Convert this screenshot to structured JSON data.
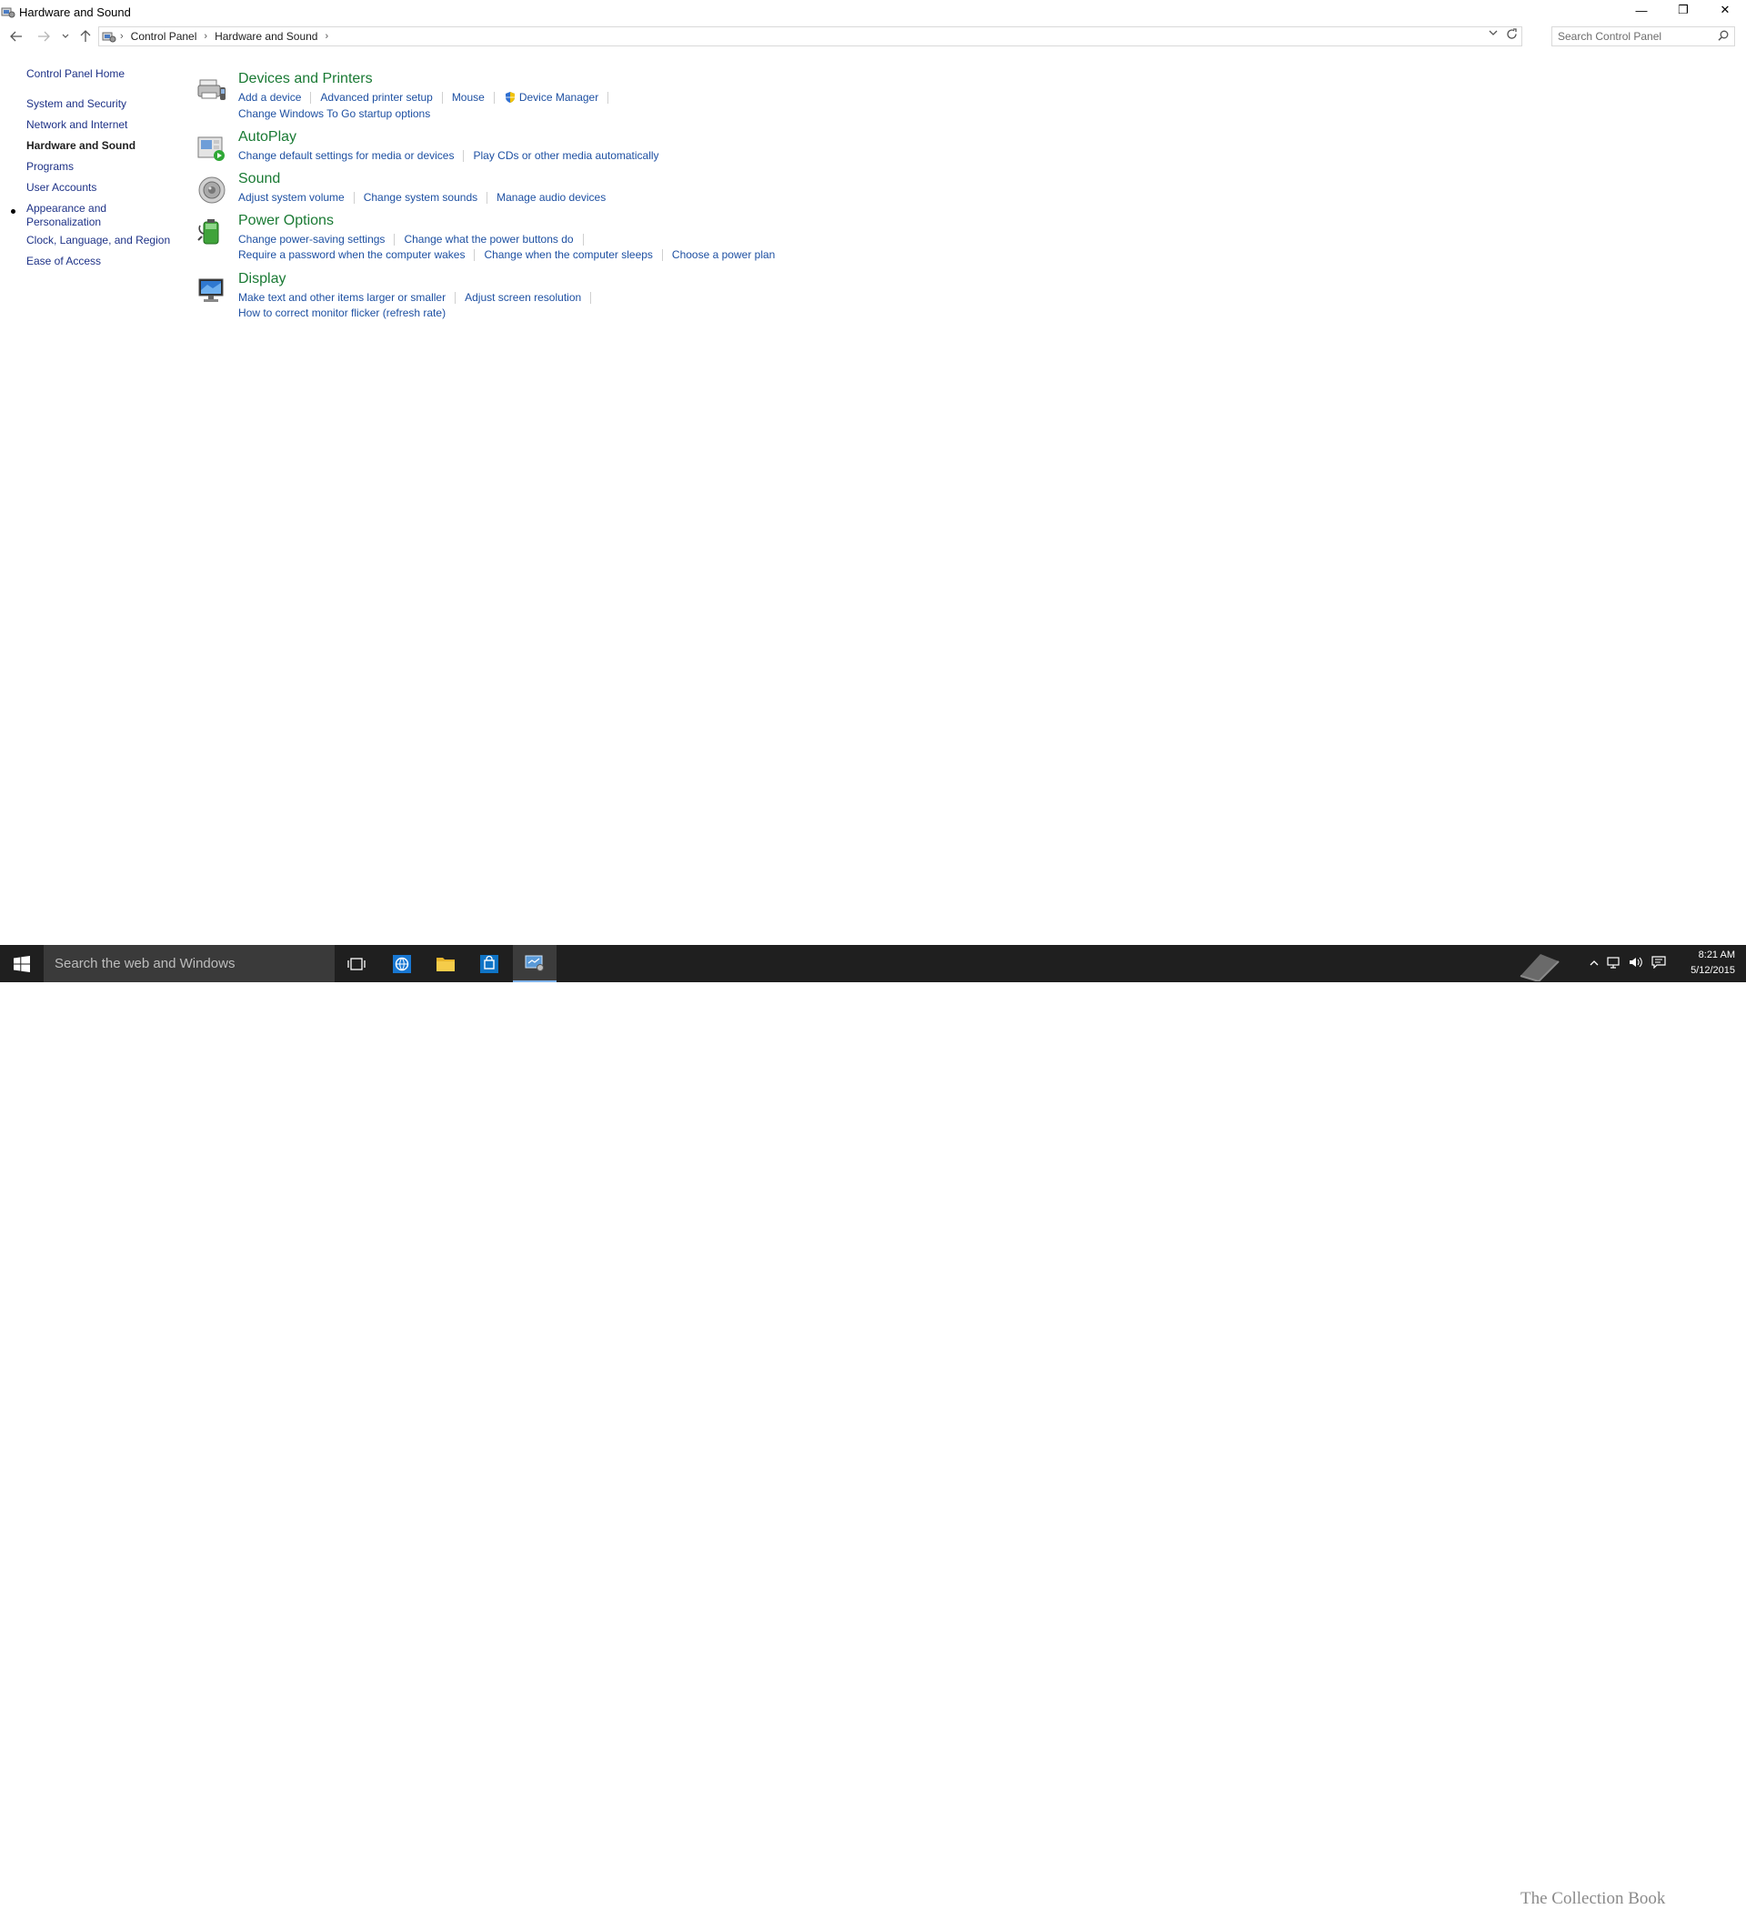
{
  "window": {
    "title": "Hardware and Sound",
    "controls": {
      "minimize": "—",
      "restore": "❐",
      "close": "✕"
    }
  },
  "address": {
    "crumbs": [
      "Control Panel",
      "Hardware and Sound"
    ],
    "search_placeholder": "Search Control Panel"
  },
  "nav": {
    "items": [
      {
        "label": "Control Panel Home"
      },
      {
        "label": "System and Security"
      },
      {
        "label": "Network and Internet"
      },
      {
        "label": "Hardware and Sound"
      },
      {
        "label": "Programs"
      },
      {
        "label": "User Accounts"
      },
      {
        "label": "Appearance and Personalization"
      },
      {
        "label": "Clock, Language, and Region"
      },
      {
        "label": "Ease of Access"
      }
    ]
  },
  "categories": [
    {
      "title": "Devices and Printers",
      "icon": "printer-icon",
      "rows": [
        [
          "Add a device",
          "Advanced printer setup",
          "Mouse",
          "Device Manager"
        ],
        [
          "Change Windows To Go startup options"
        ]
      ]
    },
    {
      "title": "AutoPlay",
      "icon": "autoplay-icon",
      "rows": [
        [
          "Change default settings for media or devices",
          "Play CDs or other media automatically"
        ]
      ]
    },
    {
      "title": "Sound",
      "icon": "speaker-icon",
      "rows": [
        [
          "Adjust system volume",
          "Change system sounds",
          "Manage audio devices"
        ]
      ]
    },
    {
      "title": "Power Options",
      "icon": "battery-icon",
      "rows": [
        [
          "Change power-saving settings",
          "Change what the power buttons do"
        ],
        [
          "Require a password when the computer wakes",
          "Change when the computer sleeps",
          "Choose a power plan"
        ]
      ]
    },
    {
      "title": "Display",
      "icon": "monitor-icon",
      "rows": [
        [
          "Make text and other items larger or smaller",
          "Adjust screen resolution"
        ],
        [
          "How to correct monitor flicker (refresh rate)"
        ]
      ]
    }
  ],
  "taskbar": {
    "search_text": "Search the web and Windows",
    "watermark": "The Collection Book",
    "time": "8:21 AM",
    "date": "5/12/2015"
  },
  "colors": {
    "link": "#1e50a2",
    "category_title": "#1a7a34",
    "nav_link": "#1e3287",
    "taskbar": "#1f1f1f"
  }
}
